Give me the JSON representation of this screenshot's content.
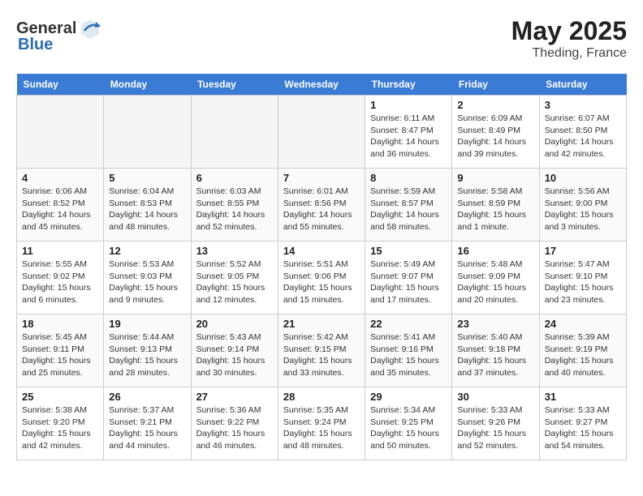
{
  "header": {
    "logo_general": "General",
    "logo_blue": "Blue",
    "month_year": "May 2025",
    "location": "Theding, France"
  },
  "days_of_week": [
    "Sunday",
    "Monday",
    "Tuesday",
    "Wednesday",
    "Thursday",
    "Friday",
    "Saturday"
  ],
  "weeks": [
    [
      {
        "day": "",
        "info": "",
        "empty": true
      },
      {
        "day": "",
        "info": "",
        "empty": true
      },
      {
        "day": "",
        "info": "",
        "empty": true
      },
      {
        "day": "",
        "info": "",
        "empty": true
      },
      {
        "day": "1",
        "info": "Sunrise: 6:11 AM\nSunset: 8:47 PM\nDaylight: 14 hours\nand 36 minutes."
      },
      {
        "day": "2",
        "info": "Sunrise: 6:09 AM\nSunset: 8:49 PM\nDaylight: 14 hours\nand 39 minutes."
      },
      {
        "day": "3",
        "info": "Sunrise: 6:07 AM\nSunset: 8:50 PM\nDaylight: 14 hours\nand 42 minutes."
      }
    ],
    [
      {
        "day": "4",
        "info": "Sunrise: 6:06 AM\nSunset: 8:52 PM\nDaylight: 14 hours\nand 45 minutes."
      },
      {
        "day": "5",
        "info": "Sunrise: 6:04 AM\nSunset: 8:53 PM\nDaylight: 14 hours\nand 48 minutes."
      },
      {
        "day": "6",
        "info": "Sunrise: 6:03 AM\nSunset: 8:55 PM\nDaylight: 14 hours\nand 52 minutes."
      },
      {
        "day": "7",
        "info": "Sunrise: 6:01 AM\nSunset: 8:56 PM\nDaylight: 14 hours\nand 55 minutes."
      },
      {
        "day": "8",
        "info": "Sunrise: 5:59 AM\nSunset: 8:57 PM\nDaylight: 14 hours\nand 58 minutes."
      },
      {
        "day": "9",
        "info": "Sunrise: 5:58 AM\nSunset: 8:59 PM\nDaylight: 15 hours\nand 1 minute."
      },
      {
        "day": "10",
        "info": "Sunrise: 5:56 AM\nSunset: 9:00 PM\nDaylight: 15 hours\nand 3 minutes."
      }
    ],
    [
      {
        "day": "11",
        "info": "Sunrise: 5:55 AM\nSunset: 9:02 PM\nDaylight: 15 hours\nand 6 minutes."
      },
      {
        "day": "12",
        "info": "Sunrise: 5:53 AM\nSunset: 9:03 PM\nDaylight: 15 hours\nand 9 minutes."
      },
      {
        "day": "13",
        "info": "Sunrise: 5:52 AM\nSunset: 9:05 PM\nDaylight: 15 hours\nand 12 minutes."
      },
      {
        "day": "14",
        "info": "Sunrise: 5:51 AM\nSunset: 9:06 PM\nDaylight: 15 hours\nand 15 minutes."
      },
      {
        "day": "15",
        "info": "Sunrise: 5:49 AM\nSunset: 9:07 PM\nDaylight: 15 hours\nand 17 minutes."
      },
      {
        "day": "16",
        "info": "Sunrise: 5:48 AM\nSunset: 9:09 PM\nDaylight: 15 hours\nand 20 minutes."
      },
      {
        "day": "17",
        "info": "Sunrise: 5:47 AM\nSunset: 9:10 PM\nDaylight: 15 hours\nand 23 minutes."
      }
    ],
    [
      {
        "day": "18",
        "info": "Sunrise: 5:45 AM\nSunset: 9:11 PM\nDaylight: 15 hours\nand 25 minutes."
      },
      {
        "day": "19",
        "info": "Sunrise: 5:44 AM\nSunset: 9:13 PM\nDaylight: 15 hours\nand 28 minutes."
      },
      {
        "day": "20",
        "info": "Sunrise: 5:43 AM\nSunset: 9:14 PM\nDaylight: 15 hours\nand 30 minutes."
      },
      {
        "day": "21",
        "info": "Sunrise: 5:42 AM\nSunset: 9:15 PM\nDaylight: 15 hours\nand 33 minutes."
      },
      {
        "day": "22",
        "info": "Sunrise: 5:41 AM\nSunset: 9:16 PM\nDaylight: 15 hours\nand 35 minutes."
      },
      {
        "day": "23",
        "info": "Sunrise: 5:40 AM\nSunset: 9:18 PM\nDaylight: 15 hours\nand 37 minutes."
      },
      {
        "day": "24",
        "info": "Sunrise: 5:39 AM\nSunset: 9:19 PM\nDaylight: 15 hours\nand 40 minutes."
      }
    ],
    [
      {
        "day": "25",
        "info": "Sunrise: 5:38 AM\nSunset: 9:20 PM\nDaylight: 15 hours\nand 42 minutes."
      },
      {
        "day": "26",
        "info": "Sunrise: 5:37 AM\nSunset: 9:21 PM\nDaylight: 15 hours\nand 44 minutes."
      },
      {
        "day": "27",
        "info": "Sunrise: 5:36 AM\nSunset: 9:22 PM\nDaylight: 15 hours\nand 46 minutes."
      },
      {
        "day": "28",
        "info": "Sunrise: 5:35 AM\nSunset: 9:24 PM\nDaylight: 15 hours\nand 48 minutes."
      },
      {
        "day": "29",
        "info": "Sunrise: 5:34 AM\nSunset: 9:25 PM\nDaylight: 15 hours\nand 50 minutes."
      },
      {
        "day": "30",
        "info": "Sunrise: 5:33 AM\nSunset: 9:26 PM\nDaylight: 15 hours\nand 52 minutes."
      },
      {
        "day": "31",
        "info": "Sunrise: 5:33 AM\nSunset: 9:27 PM\nDaylight: 15 hours\nand 54 minutes."
      }
    ]
  ]
}
